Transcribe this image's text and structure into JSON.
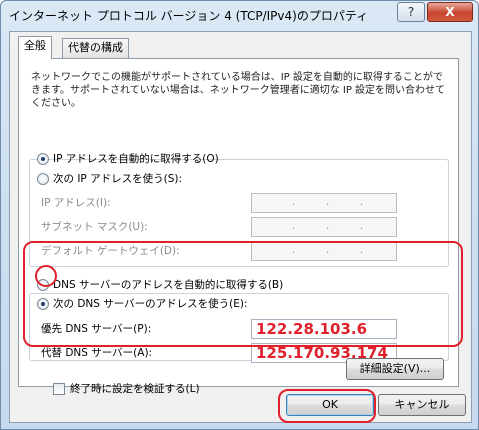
{
  "window": {
    "title": "インターネット プロトコル バージョン 4 (TCP/IPv4)のプロパティ",
    "help_label": "?",
    "close_label": "X"
  },
  "tabs": [
    "全般",
    "代替の構成"
  ],
  "description": "ネットワークでこの機能がサポートされている場合は、IP 設定を自動的に取得することができます。サポートされていない場合は、ネットワーク管理者に適切な IP 設定を問い合わせてください。",
  "ip": {
    "auto_label": "IP アドレスを自動的に取得する(O)",
    "manual_label": "次の IP アドレスを使う(S):",
    "selected": "auto",
    "fields": [
      {
        "label": "IP アドレス(I):",
        "value": ""
      },
      {
        "label": "サブネット マスク(U):",
        "value": ""
      },
      {
        "label": "デフォルト ゲートウェイ(D):",
        "value": ""
      }
    ]
  },
  "dns": {
    "auto_label": "DNS サーバーのアドレスを自動的に取得する(B)",
    "manual_label": "次の DNS サーバーのアドレスを使う(E):",
    "selected": "manual",
    "fields": [
      {
        "label": "優先 DNS サーバー(P):",
        "value": "122.28.103.6"
      },
      {
        "label": "代替 DNS サーバー(A):",
        "value": "125.170.93.174"
      }
    ]
  },
  "validate_on_exit_label": "終了時に設定を検証する(L)",
  "advanced_button": "詳細設定(V)...",
  "ok_button": "OK",
  "cancel_button": "キャンセル",
  "colors": {
    "annotation_red": "#e0202a",
    "dns_value_red": "#e0202a"
  }
}
